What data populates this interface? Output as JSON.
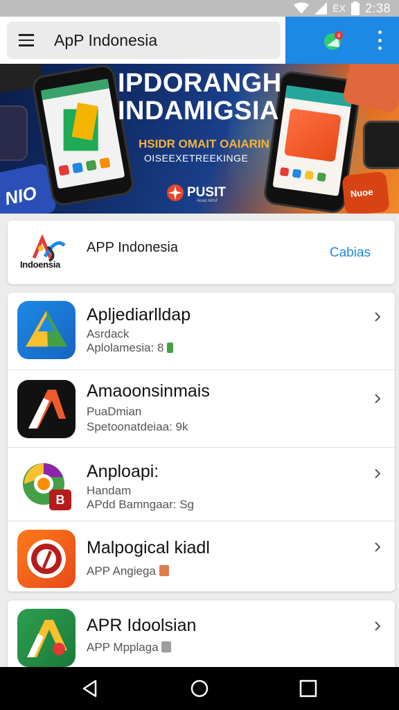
{
  "status_bar": {
    "network_label": "ЁX",
    "time": "2:38",
    "icons": [
      "wifi-icon",
      "signal-icon",
      "battery-icon"
    ]
  },
  "app_bar": {
    "title": "ApP Indonesia",
    "menu_icon": "menu-icon",
    "notification_badge": "4",
    "more_icon": "more-vert-icon"
  },
  "banner": {
    "title_line1": "IPDORANGH",
    "title_line2": "INDAMIGSIA",
    "subtitle": "HSIDR OMAIT OAIARIN",
    "subtitle2": "OISEEXETREEKINGE",
    "brand": "PUSIT",
    "brand_sub": "Aiuas kirtuf",
    "phone_badge": "Nuoe",
    "left_edge_text": "NIO"
  },
  "featured": {
    "logo_text": "Indoensia",
    "name": "APP Indonesia",
    "action_label": "Cabias"
  },
  "apps": [
    {
      "title": "Apljediarlldap",
      "line1": "Asrdack",
      "line2": "Aplolamesia: 8",
      "icon": "triangle-app-icon"
    },
    {
      "title": "Amaoonsinmais",
      "line1": "PuaDmian",
      "line2": "Spetoonatdeiaa: 9k",
      "icon": "a-letter-app-icon"
    },
    {
      "title": "Anploapi:",
      "line1": "Handam",
      "line2": "APdd Bamngaar: Sg",
      "icon": "chrome-like-app-icon"
    },
    {
      "title": "Malpogical kiadl",
      "line1": "APP Angiega",
      "line2": "",
      "icon": "shield-app-icon"
    }
  ],
  "apps_bottom": [
    {
      "title": "APR Idoolsian",
      "line1": "APP Mpplaga",
      "icon": "green-a-app-icon"
    }
  ],
  "colors": {
    "accent": "#1e88e5",
    "status_bar": "#bdbdbd",
    "nav_bar": "#000000"
  },
  "nav": {
    "icons": [
      "back-icon",
      "home-icon",
      "recents-icon"
    ]
  }
}
